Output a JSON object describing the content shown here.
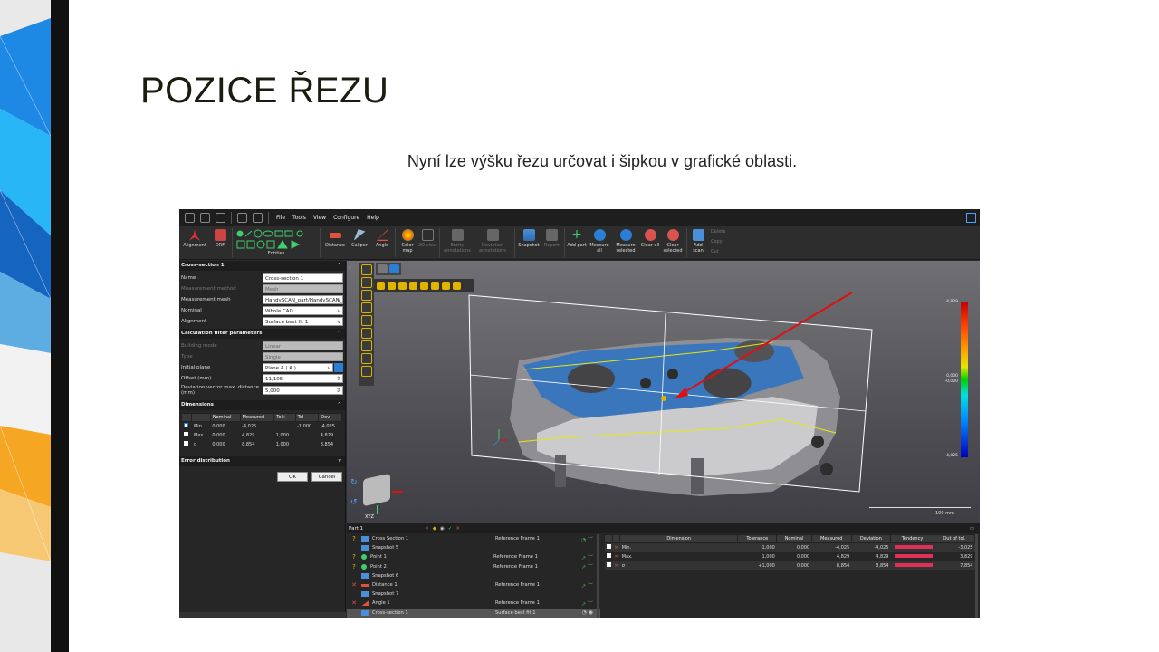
{
  "slide": {
    "title": "POZICE ŘEZU",
    "subtitle": "Nyní lze výšku řezu určovat i šipkou v grafické oblasti."
  },
  "colors": {
    "accent_yellow": "#e0b400",
    "deviation_bar": "#e0305a",
    "arrow_red": "#e01010"
  },
  "menu": [
    "File",
    "Tools",
    "View",
    "Configure",
    "Help"
  ],
  "ribbon": [
    {
      "label": "Alignment",
      "icon": "alignment-icon"
    },
    {
      "label": "DRF",
      "icon": "drf-icon"
    },
    {
      "label": "Entities",
      "icon": "entities-icon"
    },
    {
      "label": "Distance",
      "icon": "distance-icon"
    },
    {
      "label": "Caliper",
      "icon": "caliper-icon"
    },
    {
      "label": "Angle",
      "icon": "angle-icon"
    },
    {
      "label": "Color map",
      "icon": "color-map-icon"
    },
    {
      "label": "2D view",
      "icon": "2d-view-icon"
    },
    {
      "label": "Entity annotations",
      "icon": "entity-annotations-icon"
    },
    {
      "label": "Deviation annotations",
      "icon": "deviation-annotations-icon"
    },
    {
      "label": "Snapshot",
      "icon": "snapshot-icon"
    },
    {
      "label": "Report",
      "icon": "report-icon"
    },
    {
      "label": "Add part",
      "icon": "add-part-icon"
    },
    {
      "label": "Measure all",
      "icon": "measure-all-icon"
    },
    {
      "label": "Measure selected",
      "icon": "measure-selected-icon"
    },
    {
      "label": "Clear all",
      "icon": "clear-all-icon"
    },
    {
      "label": "Clear selected",
      "icon": "clear-selected-icon"
    },
    {
      "label": "Add scan",
      "icon": "add-scan-icon"
    }
  ],
  "edit_actions": [
    "Delete",
    "Copy",
    "Cut"
  ],
  "panel": {
    "section1": "Cross-section 1",
    "name_label": "Name",
    "name_value": "Cross-section 1",
    "method_label": "Measurement method",
    "method_value": "Mesh",
    "mesh_label": "Measurement mesh",
    "mesh_value": "HandySCAN_part/HandySCAN_",
    "nominal_label": "Nominal",
    "nominal_value": "Whole CAD",
    "alignment_label": "Alignment",
    "alignment_value": "Surface best fit 1",
    "section2": "Calculation filter parameters",
    "building_label": "Building mode",
    "building_value": "Linear",
    "type_label": "Type",
    "type_value": "Single",
    "plane_label": "Initial plane",
    "plane_value": "Plane A ( A )",
    "offset_label": "Offset (mm)",
    "offset_value": "11,105",
    "devmax_label": "Deviation vector max. distance (mm)",
    "devmax_value": "5,000",
    "section3": "Dimensions",
    "dim_headers": [
      "Nominal",
      "Measured",
      "Tol+",
      "Tol-",
      "Dev."
    ],
    "dim_rows": [
      {
        "name": "Min.",
        "nominal": "0,000",
        "measured": "-4,025",
        "tolp": "",
        "tolm": "-1,000",
        "dev": "-4,025"
      },
      {
        "name": "Max.",
        "nominal": "0,000",
        "measured": "4,829",
        "tolp": "1,000",
        "tolm": "",
        "dev": "4,829"
      },
      {
        "name": "σ",
        "nominal": "0,000",
        "measured": "8,854",
        "tolp": "1,000",
        "tolm": "",
        "dev": "8,854"
      }
    ],
    "section4": "Error distribution",
    "ok": "OK",
    "cancel": "Cancel"
  },
  "viewport": {
    "scale_top": "4,829",
    "scale_mid1": "0,000",
    "scale_mid2": "-0,000",
    "scale_bottom": "-4,025",
    "scalebar": "100 mm",
    "axis": "XYZ"
  },
  "tree": {
    "part": "Part 1",
    "rows": [
      {
        "mark": "?",
        "name": "Cross Section 1",
        "ref": "Reference Frame 1"
      },
      {
        "mark": "",
        "name": "Snapshot 5",
        "ref": ""
      },
      {
        "mark": "?",
        "name": "Point 1",
        "ref": "Reference Frame 1"
      },
      {
        "mark": "?",
        "name": "Point 2",
        "ref": "Reference Frame 1"
      },
      {
        "mark": "",
        "name": "Snapshot 6",
        "ref": ""
      },
      {
        "mark": "✕",
        "name": "Distance 1",
        "ref": "Reference Frame 1"
      },
      {
        "mark": "",
        "name": "Snapshot 7",
        "ref": ""
      },
      {
        "mark": "✕",
        "name": "Angle 1",
        "ref": "Reference Frame 1"
      },
      {
        "mark": "",
        "name": "Cross-section 1",
        "ref": "Surface best fit 1"
      }
    ]
  },
  "results": {
    "headers": [
      "Dimension",
      "Tolerance",
      "Nominal",
      "Measured",
      "Deviation",
      "Tendency",
      "Out of tol."
    ],
    "rows": [
      {
        "dim": "Min.",
        "tol": "-1,000",
        "nom": "0,000",
        "meas": "-4,025",
        "dev": "-4,025",
        "out": "-3,025"
      },
      {
        "dim": "Max.",
        "tol": "1,000",
        "nom": "0,000",
        "meas": "4,829",
        "dev": "4,829",
        "out": "3,829"
      },
      {
        "dim": "σ",
        "tol": "+1,000",
        "nom": "0,000",
        "meas": "8,854",
        "dev": "8,854",
        "out": "7,854"
      }
    ]
  }
}
